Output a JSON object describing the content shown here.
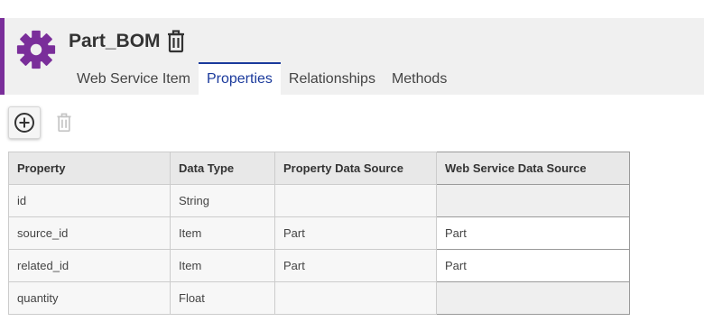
{
  "header": {
    "title": "Part_BOM",
    "accent_color": "#7a2e9a",
    "icon": "gear-icon",
    "delete_icon": "trash-icon"
  },
  "tabs": [
    {
      "label": "Web Service Item",
      "active": false
    },
    {
      "label": "Properties",
      "active": true
    },
    {
      "label": "Relationships",
      "active": false
    },
    {
      "label": "Methods",
      "active": false
    }
  ],
  "toolbar": {
    "add_icon": "plus-circle-icon",
    "delete_icon": "trash-icon",
    "delete_disabled": true
  },
  "table": {
    "columns": [
      "Property",
      "Data Type",
      "Property Data Source",
      "Web Service Data Source"
    ],
    "rows": [
      [
        "id",
        "String",
        "",
        ""
      ],
      [
        "source_id",
        "Item",
        "Part",
        "Part"
      ],
      [
        "related_id",
        "Item",
        "Part",
        "Part"
      ],
      [
        "quantity",
        "Float",
        "",
        ""
      ]
    ]
  }
}
